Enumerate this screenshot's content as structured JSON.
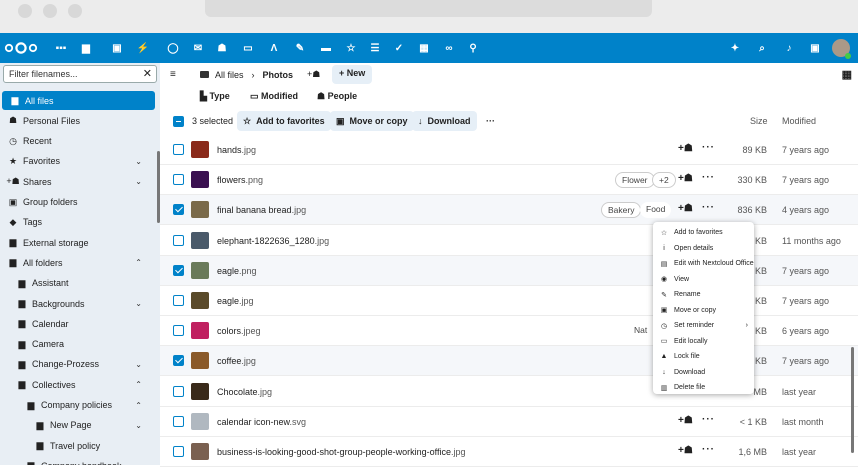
{
  "header": {
    "icons": [
      "dashboard-icon",
      "files-icon",
      "photos-icon",
      "activity-icon",
      "search-icon",
      "mail-icon",
      "contacts-icon",
      "calendar-icon",
      "notes-icon",
      "pencil-icon",
      "deck-icon",
      "favorites-icon",
      "tasks-icon",
      "checklist-icon",
      "tables-icon",
      "links-icon",
      "maps-icon"
    ],
    "right_icons": [
      "assistant-icon",
      "search-icon",
      "notifications-icon",
      "contacts-menu-icon",
      "avatar"
    ]
  },
  "sidebar": {
    "filter_placeholder": "Filter filenames...",
    "items": [
      {
        "label": "All files",
        "icon": "folder-icon",
        "active": true
      },
      {
        "label": "Personal Files",
        "icon": "user-icon"
      },
      {
        "label": "Recent",
        "icon": "clock-icon"
      },
      {
        "label": "Favorites",
        "icon": "star-icon",
        "chevron": "⌄"
      },
      {
        "label": "Shares",
        "icon": "share-icon",
        "chevron": "⌄"
      },
      {
        "label": "Group folders",
        "icon": "group-folder-icon"
      },
      {
        "label": "Tags",
        "icon": "tag-icon"
      },
      {
        "label": "External storage",
        "icon": "storage-icon"
      },
      {
        "label": "All folders",
        "icon": "folder-multiple-icon",
        "chevron": "⌃"
      },
      {
        "label": "Assistant",
        "icon": "folder-icon",
        "indent": 1
      },
      {
        "label": "Backgrounds",
        "icon": "folder-icon",
        "indent": 1,
        "chevron": "⌄"
      },
      {
        "label": "Calendar",
        "icon": "folder-icon",
        "indent": 1
      },
      {
        "label": "Camera",
        "icon": "folder-icon",
        "indent": 1
      },
      {
        "label": "Change-Prozess",
        "icon": "folder-icon",
        "indent": 1,
        "chevron": "⌄"
      },
      {
        "label": "Collectives",
        "icon": "folder-icon",
        "indent": 1,
        "chevron": "⌃"
      },
      {
        "label": "Company policies",
        "icon": "folder-icon",
        "indent": 2,
        "chevron": "⌃"
      },
      {
        "label": "New Page",
        "icon": "folder-icon",
        "indent": 3,
        "chevron": "⌄"
      },
      {
        "label": "Travel policy",
        "icon": "folder-icon",
        "indent": 3
      },
      {
        "label": "Company handbook",
        "icon": "folder-icon",
        "indent": 2,
        "chevron": "⌄"
      }
    ]
  },
  "breadcrumb": {
    "root": "All files",
    "current": "Photos",
    "new_label": "+ New"
  },
  "filters": {
    "type": "Type",
    "modified": "Modified",
    "people": "People"
  },
  "selection": {
    "count_label": "3 selected",
    "add_favorites": "Add to favorites",
    "move_copy": "Move or copy",
    "download": "Download",
    "more": "···"
  },
  "columns": {
    "size": "Size",
    "modified": "Modified"
  },
  "files": [
    {
      "name": "hands",
      "ext": ".jpg",
      "size": "89 KB",
      "modified": "7 years ago",
      "checked": false,
      "thumb": "#8a2a1a"
    },
    {
      "name": "flowers",
      "ext": ".png",
      "size": "330 KB",
      "modified": "7 years ago",
      "checked": false,
      "thumb": "#3a1050",
      "tags": [
        "Flower",
        "+2"
      ]
    },
    {
      "name": "final banana bread",
      "ext": ".jpg",
      "size": "836 KB",
      "modified": "4 years ago",
      "checked": true,
      "thumb": "#7a6a4a",
      "tags": [
        "Bakery",
        "Food"
      ]
    },
    {
      "name": "elephant-1822636_1280",
      "ext": ".jpg",
      "size": "KB",
      "modified": "11 months ago",
      "checked": false,
      "thumb": "#4a5a6a"
    },
    {
      "name": "eagle",
      "ext": ".png",
      "size": "KB",
      "modified": "7 years ago",
      "checked": true,
      "thumb": "#6a7a5a"
    },
    {
      "name": "eagle",
      "ext": ".jpg",
      "size": "KB",
      "modified": "7 years ago",
      "checked": false,
      "thumb": "#5a4a2a"
    },
    {
      "name": "colors",
      "ext": ".jpeg",
      "size": "KB",
      "modified": "6 years ago",
      "checked": false,
      "thumb": "#c02060",
      "tags": [
        "Nat"
      ]
    },
    {
      "name": "coffee",
      "ext": ".jpg",
      "size": "KB",
      "modified": "7 years ago",
      "checked": true,
      "thumb": "#8a5a2a"
    },
    {
      "name": "Chocolate",
      "ext": ".jpg",
      "size": "MB",
      "modified": "last year",
      "checked": false,
      "thumb": "#3a2a1a"
    },
    {
      "name": "calendar icon-new",
      "ext": ".svg",
      "size": "< 1 KB",
      "modified": "last month",
      "checked": false,
      "thumb": "#b0b8c0"
    },
    {
      "name": "business-is-looking-good-shot-group-people-working-office",
      "ext": ".jpg",
      "size": "1,6 MB",
      "modified": "last year",
      "checked": false,
      "thumb": "#7a6050"
    }
  ],
  "context_menu": [
    {
      "label": "Add to favorites",
      "icon": "star-outline-icon"
    },
    {
      "label": "Open details",
      "icon": "info-icon"
    },
    {
      "label": "Edit with Nextcloud Office",
      "icon": "document-icon"
    },
    {
      "label": "View",
      "icon": "eye-icon"
    },
    {
      "label": "Rename",
      "icon": "pencil-icon"
    },
    {
      "label": "Move or copy",
      "icon": "folder-move-icon"
    },
    {
      "label": "Set reminder",
      "icon": "alarm-icon",
      "submenu": true
    },
    {
      "label": "Edit locally",
      "icon": "laptop-icon"
    },
    {
      "label": "Lock file",
      "icon": "lock-icon"
    },
    {
      "label": "Download",
      "icon": "download-icon"
    },
    {
      "label": "Delete file",
      "icon": "trash-icon"
    }
  ]
}
